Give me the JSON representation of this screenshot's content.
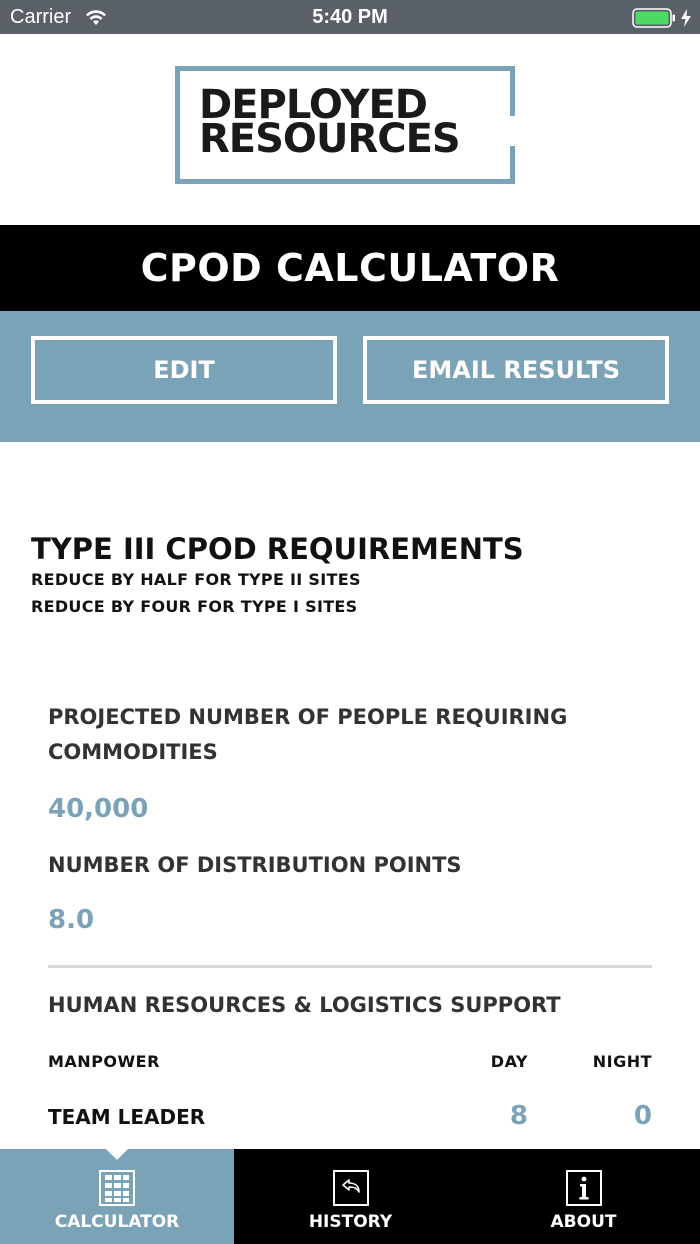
{
  "status_bar": {
    "carrier": "Carrier",
    "time": "5:40 PM",
    "battery_color": "#4cd964"
  },
  "logo": {
    "line1": "DEPLOYED",
    "line2": "RESOURCES",
    "frame_color": "#7ba3b8"
  },
  "header": {
    "title": "CPOD CALCULATOR"
  },
  "actions": {
    "edit_label": "EDIT",
    "email_label": "EMAIL RESULTS"
  },
  "requirements": {
    "title": "TYPE III CPOD REQUIREMENTS",
    "note1": "REDUCE BY HALF FOR TYPE II SITES",
    "note2": "REDUCE BY FOUR FOR TYPE I SITES"
  },
  "fields": {
    "people_label": "PROJECTED NUMBER OF PEOPLE REQUIRING COMMODITIES",
    "people_value": "40,000",
    "points_label": "NUMBER OF DISTRIBUTION POINTS",
    "points_value": "8.0"
  },
  "hr_section": {
    "title": "HUMAN RESOURCES & LOGISTICS SUPPORT",
    "columns": {
      "manpower": "MANPOWER",
      "day": "DAY",
      "night": "NIGHT"
    },
    "rows": [
      {
        "label": "TEAM LEADER",
        "day": "8",
        "night": "0"
      }
    ]
  },
  "tabs": [
    {
      "label": "CALCULATOR",
      "icon": "calculator-icon",
      "active": true
    },
    {
      "label": "HISTORY",
      "icon": "history-icon",
      "active": false
    },
    {
      "label": "ABOUT",
      "icon": "info-icon",
      "active": false
    }
  ],
  "colors": {
    "accent": "#7ba3b8",
    "header_bg": "#000000",
    "status_bg": "#5a6068"
  }
}
